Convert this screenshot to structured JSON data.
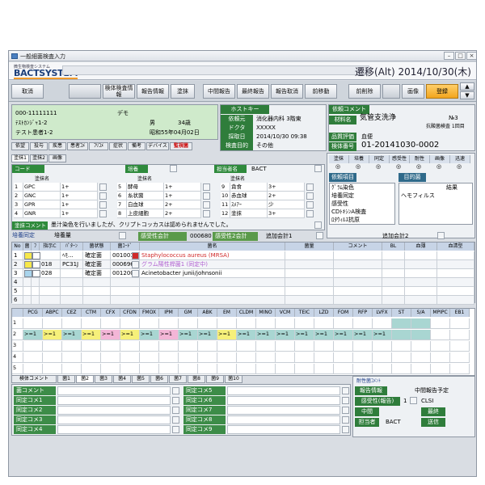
{
  "window": {
    "title": "一般細菌検査入力",
    "minimize": "–",
    "maximize": "□",
    "close": "×"
  },
  "header": {
    "logo_sub": "微生物検査システム",
    "logo": "BACTSYSTEM",
    "date": "遷移(Alt) 2014/10/30(木)"
  },
  "toolbar": {
    "cancel": "取消",
    "extra1": "",
    "workcomment": "検体検査情報",
    "reportinfo": "報告情報",
    "smear": "塗抹",
    "interim": "中間報告",
    "final": "最終報告",
    "report_cancel": "報告取消",
    "prev_label": "前移動",
    "delete": "前削除",
    "image": "画像",
    "register": "登録",
    "up": "▲",
    "down": "▼"
  },
  "patient": {
    "id": "000-11111111",
    "kana": "ﾃｽﾄｶﾝｼﾞｬ1-2",
    "name": "テスト患者1-2",
    "demo": "デモ",
    "sex": "男",
    "age": "34歳",
    "birth": "昭和55年04月02日"
  },
  "host": {
    "title": "ホストキー",
    "rows": [
      {
        "label": "依頼元",
        "value": "消化器内科 3階東"
      },
      {
        "label": "ドクタ",
        "value": "XXXXX"
      },
      {
        "label": "採取日",
        "value": "2014/10/30      09:38"
      },
      {
        "label": "検査目的",
        "value": "その他"
      }
    ]
  },
  "req": {
    "title": "依頼コメント",
    "material_label": "材料名",
    "material": "気管支洗浄",
    "material_no": "№3",
    "sub": "抗酸菌検査 1回目",
    "quality_label": "品質評価",
    "quality": "血便",
    "specimen_label": "検体番号",
    "specimen": "01-20141030-0002"
  },
  "tabs": [
    "依望",
    "投与",
    "疾患",
    "患者ｺﾒ",
    "ﾌﾘｺﾒ",
    "症状",
    "備考",
    "デバイス",
    "監視菌"
  ],
  "subtabs": [
    "塗抹1",
    "塗抹2",
    "画像"
  ],
  "smear": {
    "code_label": "コード",
    "culture_label": "培養",
    "staff_label": "担当者名",
    "staff": "BACT",
    "col1": "塗抹名",
    "col2": "塗抹名",
    "col3": "塗抹名",
    "rows": [
      [
        {
          "n": "1",
          "name": "GPC",
          "v": "1+"
        },
        {
          "n": "5",
          "name": "酵母",
          "v": "1+"
        },
        {
          "n": "9",
          "name": "貪食",
          "v": "3+"
        }
      ],
      [
        {
          "n": "2",
          "name": "GNC",
          "v": "1+"
        },
        {
          "n": "6",
          "name": "糸状菌",
          "v": "1+"
        },
        {
          "n": "10",
          "name": "赤血球",
          "v": "2+"
        }
      ],
      [
        {
          "n": "3",
          "name": "GPR",
          "v": "1+"
        },
        {
          "n": "7",
          "name": "白血球",
          "v": "2+"
        },
        {
          "n": "11",
          "name": "ｽﾒｱｰ",
          "v": "少"
        }
      ],
      [
        {
          "n": "4",
          "name": "GNR",
          "v": "1+"
        },
        {
          "n": "8",
          "name": "上皮細胞",
          "v": "2+"
        },
        {
          "n": "12",
          "name": "塗抹",
          "v": "3+"
        }
      ]
    ],
    "comment_label": "塗抹コメント",
    "comment": "墨汁染色を行いましたが、クリプトコッカスは認められませんでした。"
  },
  "sideinfo": {
    "head": [
      "塗抹",
      "培養",
      "同定",
      "感受性",
      "耐性",
      "画像",
      "迅速"
    ],
    "marks": [
      "◎",
      "◎",
      "◎",
      "◎",
      "◎",
      "◎",
      "◎"
    ],
    "req_label": "依頼項目",
    "items": [
      "ｸﾞﾗﾑ染色",
      "培養同定",
      "感受性",
      "CDﾄｷｼﾝA検査",
      "ﾛﾀｳｨﾙｽ抗原"
    ],
    "purpose_label": "目的菌",
    "purpose_head": "結果",
    "purpose": "ヘモフィルス"
  },
  "culture": {
    "label": "培養同定",
    "fields": "培養量",
    "count_label": "感受性会計",
    "count": "000680",
    "sens_label": "感受性2会計",
    "add1": "追加会計1",
    "add2": "追加会計2",
    "head": [
      "No",
      "菌",
      "ﾌ",
      "指示C",
      "ﾊﾟﾀｰﾝ",
      "菌状態",
      "菌ｺｰﾄﾞ",
      "菌名",
      "菌量",
      "コメント",
      "BL",
      "血薄",
      "血清型"
    ],
    "rows": [
      {
        "no": "1",
        "c1": "#f7e84a",
        "c2": "#ffffff",
        "sc": "",
        "pat": "ﾍﾓ...",
        "state": "確定菌",
        "code": "001001",
        "name": "Staphylococcus aureus (MRSA)",
        "namecolor": "#d02a2a"
      },
      {
        "no": "2",
        "c1": "#f7e84a",
        "c2": "#ffffff",
        "sc": "018",
        "pat": "PC31J",
        "state": "確定菌",
        "code": "000696",
        "name": "グラム陽性桿菌1 (同定中)",
        "namecolor": "#b05fd0"
      },
      {
        "no": "3",
        "c1": "#a9d4ec",
        "c2": "#ffffff",
        "sc": "028",
        "pat": "",
        "state": "確定菌",
        "code": "001200",
        "name": "Acinetobacter junii/johnsonii",
        "namecolor": "#000000"
      },
      {
        "no": "4",
        "c1": "",
        "c2": "",
        "sc": "",
        "pat": "",
        "state": "",
        "code": "",
        "name": "",
        "namecolor": "#000"
      },
      {
        "no": "5",
        "c1": "",
        "c2": "",
        "sc": "",
        "pat": "",
        "state": "",
        "code": "",
        "name": "",
        "namecolor": "#000"
      },
      {
        "no": "6",
        "c1": "",
        "c2": "",
        "sc": "",
        "pat": "",
        "state": "",
        "code": "",
        "name": "",
        "namecolor": "#000"
      }
    ]
  },
  "sens": {
    "drugs": [
      "PCG",
      "ABPC",
      "CEZ",
      "CTM",
      "CFX",
      "CFDN",
      "FMOX",
      "IPM",
      "GM",
      "ABK",
      "EM",
      "CLDM",
      "MINO",
      "VCM",
      "TEIC",
      "LZD",
      "FOM",
      "RFP",
      "LVFX",
      "ST",
      "S/A",
      "MPIPC",
      "EB1"
    ],
    "rows": [
      {
        "n": "1",
        "vals": [
          "",
          "",
          "",
          "",
          "",
          "",
          "",
          "",
          "",
          "",
          "",
          "",
          "",
          "",
          "",
          "",
          "",
          "",
          "",
          "",
          "",
          "",
          ""
        ],
        "colors": [
          "",
          "",
          "",
          "",
          "",
          "",
          "",
          "",
          "",
          "",
          "",
          "",
          "",
          "",
          "",
          "",
          "",
          "",
          "",
          "#a9d6d2",
          "#a9d6d2",
          "",
          ""
        ]
      },
      {
        "n": "2",
        "vals": [
          ">=1",
          ">=1",
          ">=1",
          ">=1",
          ">=1",
          ">=1",
          ">=1",
          ">=1",
          ">=1",
          ">=1",
          ">=1",
          ">=1",
          ">=1",
          ">=1",
          ">=1",
          ">=1",
          ">=1",
          ">=1",
          ">=1",
          "",
          "",
          "",
          ""
        ],
        "colors": [
          "#a9d6d2",
          "#f6f07a",
          "#a9d6d2",
          "#f6f07a",
          "#f3b6d7",
          "#f6f07a",
          "#a9d6d2",
          "#f3b6d7",
          "#a9d6d2",
          "#a9d6d2",
          "#f6f07a",
          "#a9d6d2",
          "#a9d6d2",
          "#a9d6d2",
          "#a9d6d2",
          "#a9d6d2",
          "#a9d6d2",
          "#a9d6d2",
          "#a9d6d2",
          "#a9d6d2",
          "#a9d6d2",
          "",
          ""
        ]
      },
      {
        "n": "3",
        "vals": [],
        "colors": []
      },
      {
        "n": "4",
        "vals": [],
        "colors": []
      },
      {
        "n": "5",
        "vals": [],
        "colors": []
      }
    ]
  },
  "bottom": {
    "tabs": [
      "検体コメント",
      "菌1",
      "菌2",
      "菌3",
      "菌4",
      "菌5",
      "菌6",
      "菌7",
      "菌8",
      "菌9",
      "菌10"
    ],
    "left": [
      "菌コメント",
      "同定コメ1",
      "同定コメ2",
      "同定コメ3",
      "同定コメ4"
    ],
    "mid": [
      "同定コメ5",
      "同定コメ6",
      "同定コメ7",
      "同定コメ8",
      "同定コメ9"
    ],
    "resist_label": "耐性菌ｺﾒﾝﾄ",
    "report_label": "報告情報",
    "report_value": "中間報告予定",
    "sens_label": "感受性(報告)",
    "sens_no": "1",
    "sens_value": "CLSI",
    "interim": "中間",
    "final": "最終",
    "staff_label": "担当者",
    "staff": "BACT",
    "sent": "送信"
  }
}
